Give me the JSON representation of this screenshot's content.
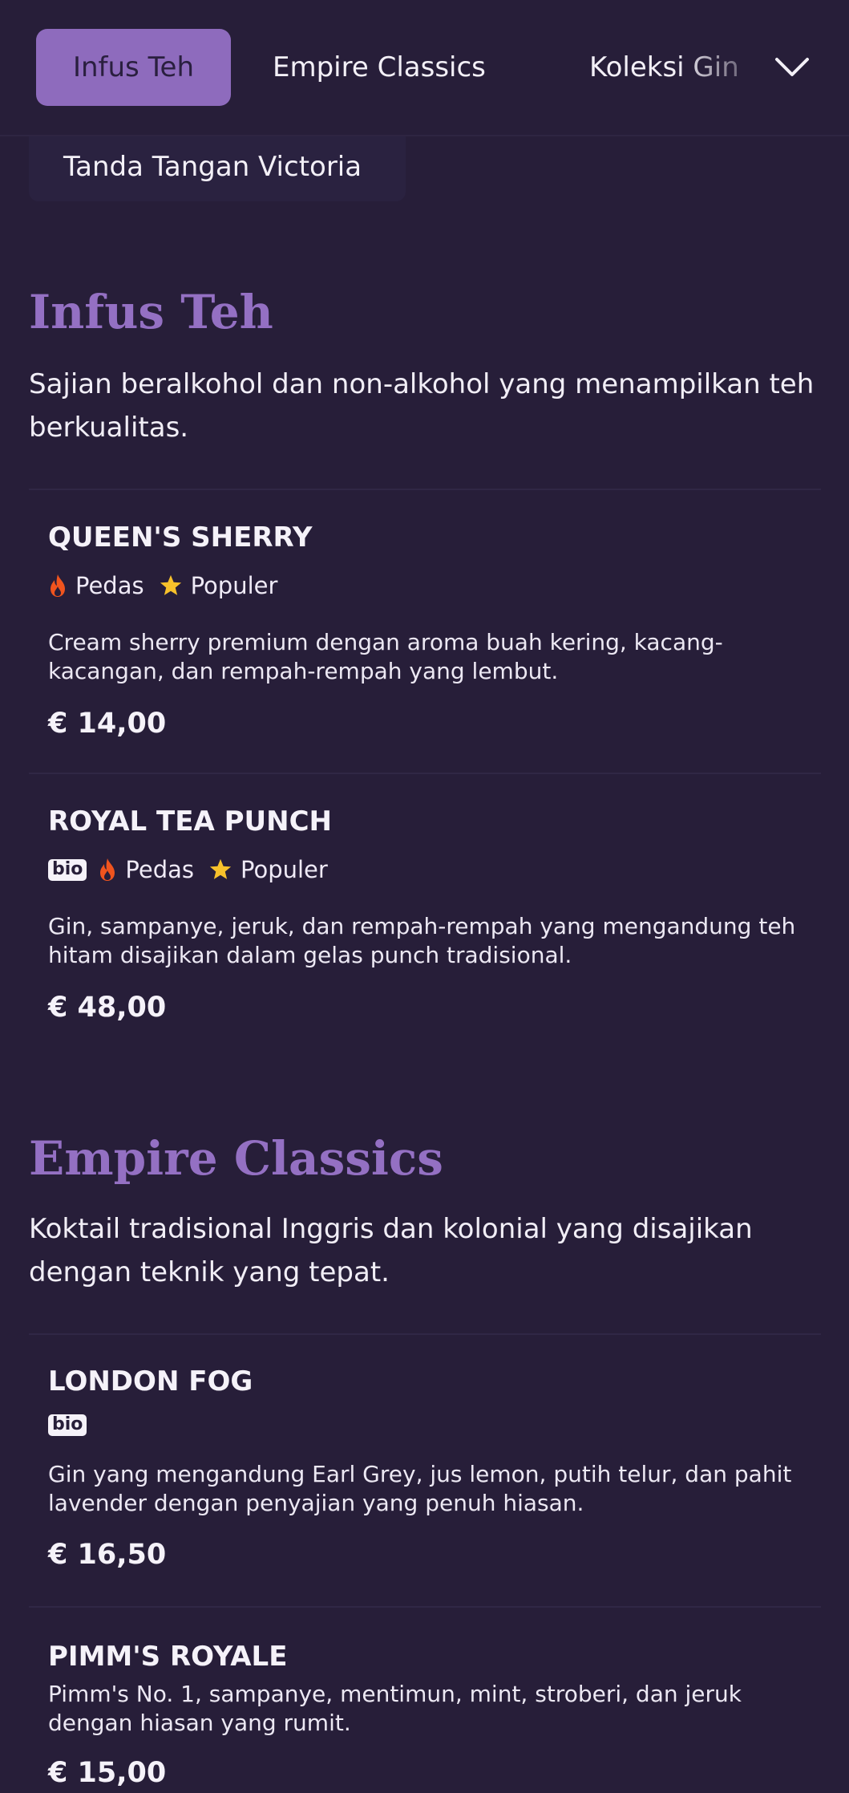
{
  "nav": {
    "tabs": [
      {
        "label": "Infus Teh",
        "active": true
      },
      {
        "label": "Empire Classics",
        "active": false
      },
      {
        "label": "Koleksi Gin",
        "active": false
      },
      {
        "label": "Tanda Tangan Victoria",
        "active": false
      }
    ],
    "expand_icon": "chevron-down-icon"
  },
  "sections": [
    {
      "title": "Infus Teh",
      "description": "Sajian beralkohol dan non-alkohol yang menampilkan teh berkualitas.",
      "items": [
        {
          "name": "QUEEN'S SHERRY",
          "tags": {
            "spicy": "Pedas",
            "popular": "Populer"
          },
          "description": "Cream sherry premium dengan aroma buah kering, kacang-kacangan, dan rempah-rempah yang lembut.",
          "price": "€ 14,00"
        },
        {
          "name": "ROYAL TEA PUNCH",
          "tags": {
            "bio": "bio",
            "spicy": "Pedas",
            "popular": "Populer"
          },
          "description": "Gin, sampanye, jeruk, dan rempah-rempah yang mengandung teh hitam disajikan dalam gelas punch tradisional.",
          "price": "€ 48,00"
        }
      ]
    },
    {
      "title": "Empire Classics",
      "description": "Koktail tradisional Inggris dan kolonial yang disajikan dengan teknik yang tepat.",
      "items": [
        {
          "name": "LONDON FOG",
          "tags": {
            "bio": "bio"
          },
          "description": "Gin yang mengandung Earl Grey, jus lemon, putih telur, dan pahit lavender dengan penyajian yang penuh hiasan.",
          "price": "€ 16,50"
        },
        {
          "name": "PIMM'S ROYALE",
          "tags": {},
          "description": "Pimm's No. 1, sampanye, mentimun, mint, stroberi, dan jeruk dengan hiasan yang rumit.",
          "price": "€ 15,00"
        }
      ]
    }
  ],
  "colors": {
    "background": "#271e39",
    "accent": "#9470c3",
    "active_tab": "#8e6bbd",
    "flame": "#f0541e",
    "star": "#f7c12b"
  }
}
